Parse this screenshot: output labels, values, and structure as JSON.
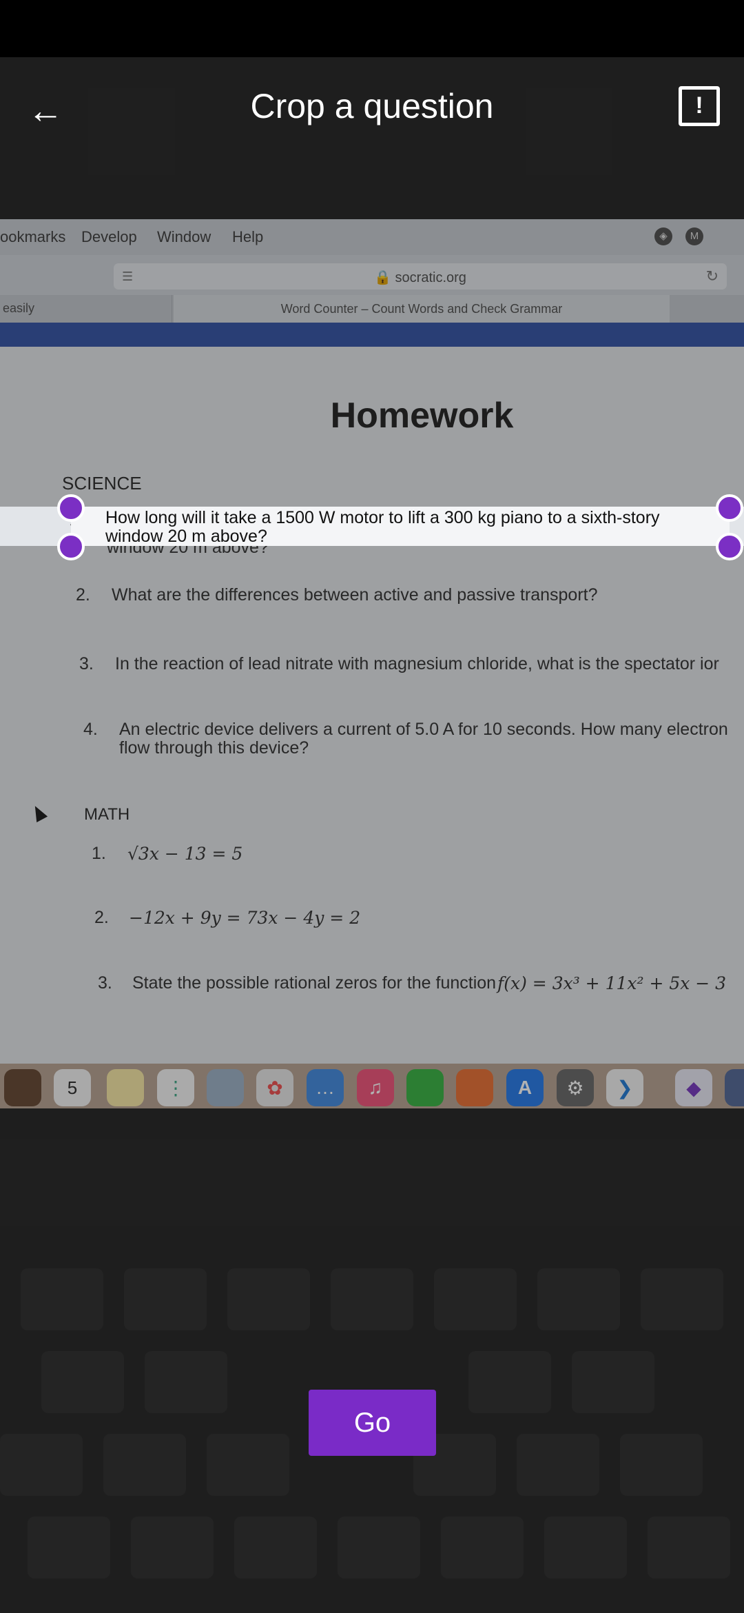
{
  "header": {
    "back_icon": "arrow-left-icon",
    "title": "Crop a question",
    "report_icon": "report-feedback-icon",
    "report_glyph": "!"
  },
  "photo": {
    "menu": [
      "ookmarks",
      "Develop",
      "Window",
      "Help"
    ],
    "menu_icons": [
      "cube-icon",
      "m-icon"
    ],
    "url": "socratic.org",
    "tab_left": "easily",
    "tab_active": "Word Counter – Count Words and Check Grammar",
    "page_title": "Homework",
    "science_heading": "SCIENCE",
    "science_questions": [
      {
        "num": "1.",
        "line1": "How long will it take a 1500 W motor to lift a 300 kg piano to a sixth-story",
        "line2": "window 20 m above?"
      },
      {
        "num": "2.",
        "line1": "What are the differences between active and passive transport?"
      },
      {
        "num": "3.",
        "line1": "In the reaction of lead nitrate with magnesium chloride, what is the spectator ior"
      },
      {
        "num": "4.",
        "line1": "An electric device delivers a current of 5.0 A for 10 seconds. How many electron",
        "line2": "flow through this device?"
      }
    ],
    "math_heading": "MATH",
    "math_questions": [
      {
        "num": "1.",
        "text": "√3x − 13 = 5"
      },
      {
        "num": "2.",
        "text": "−12x + 9y = 73x − 4y = 2"
      },
      {
        "num": "3.",
        "prefix": "State the possible rational zeros for the function",
        "expr": "f(x) = 3x³ + 11x² + 5x − 3"
      }
    ],
    "calendar_day": "5"
  },
  "actions": {
    "go_label": "Go"
  },
  "colors": {
    "accent": "#7a2bc7",
    "background": "#2c2c2c"
  }
}
